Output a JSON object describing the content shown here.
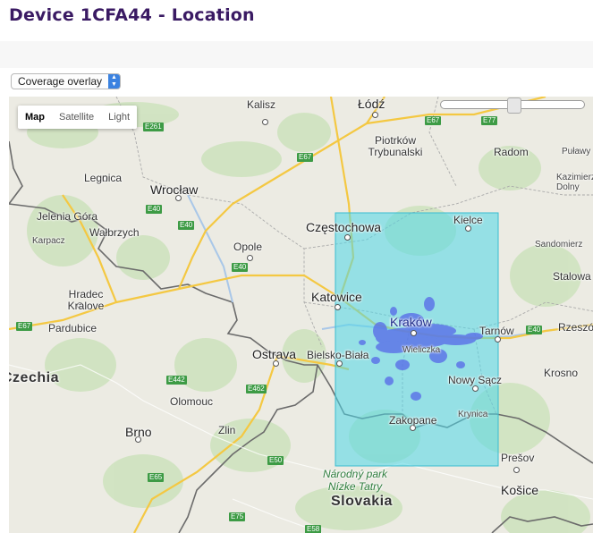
{
  "page": {
    "title": "Device 1CFA44 - Location"
  },
  "overlay_select": {
    "value": "Coverage overlay"
  },
  "map": {
    "type_controls": [
      "Map",
      "Satellite",
      "Light"
    ],
    "active_type": "Map",
    "coverage_color": "#4fd7e8",
    "signal_color": "#5a6fe8",
    "cities": [
      "Łódź",
      "Kalisz",
      "Piotrków Trybunalski",
      "Radom",
      "Puławy",
      "Kazimierz Dolny",
      "Legnica",
      "Wrocław",
      "Jelenia Góra",
      "Karpacz",
      "Wałbrzych",
      "Opole",
      "Częstochowa",
      "Kielce",
      "Sandomierz",
      "Stalowa",
      "Hradec Kralove",
      "Pardubice",
      "Katowice",
      "Kraków",
      "Wieliczka",
      "Tarnów",
      "Rzeszów",
      "Ostrava",
      "Bielsko-Biała",
      "Olomouc",
      "Krosno",
      "Nowy Sącz",
      "Krynica",
      "Zakopane",
      "Zlin",
      "Brno",
      "Prešov",
      "Košice"
    ],
    "countries": [
      "Czechia",
      "Slovakia"
    ],
    "park": "Národný park Nízke Tatry",
    "roads": [
      "E261",
      "E67",
      "E77",
      "E67",
      "E40",
      "E40",
      "E40",
      "E67",
      "E40",
      "E442",
      "E462",
      "E50",
      "E65",
      "E75",
      "E58"
    ]
  }
}
